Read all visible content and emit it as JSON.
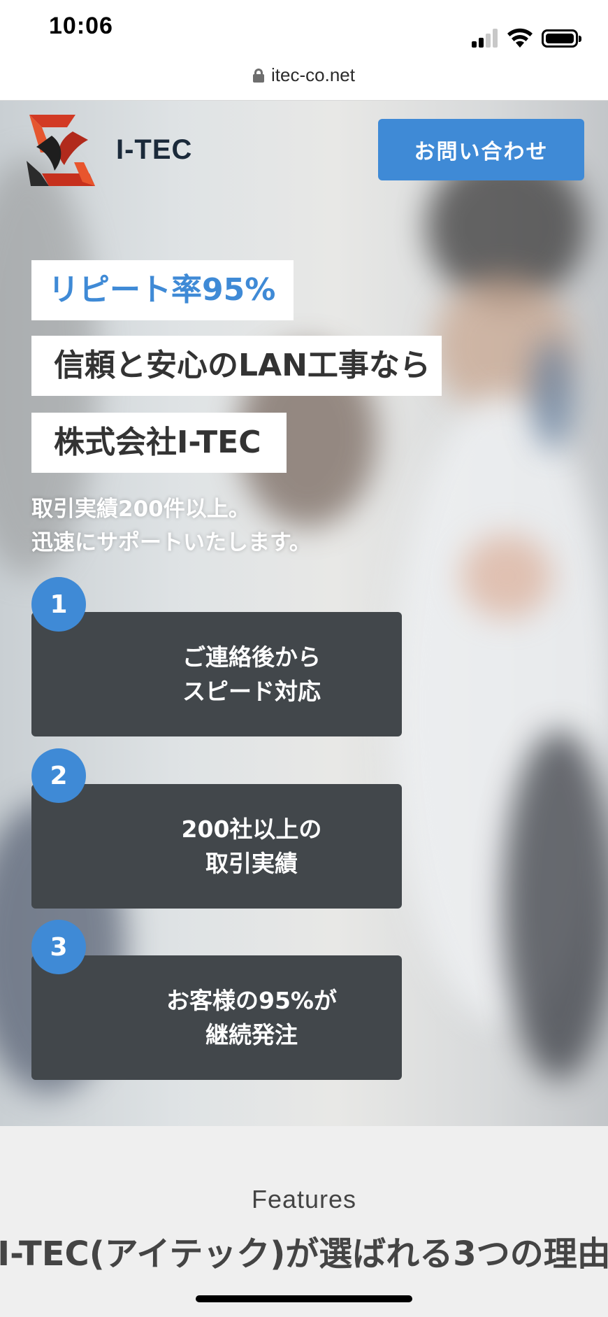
{
  "status_bar": {
    "time": "10:06"
  },
  "browser": {
    "url": "itec-co.net"
  },
  "header": {
    "brand": "I-TEC",
    "contact_button": "お問い合わせ"
  },
  "hero": {
    "tag_repeat": "リピート率95%",
    "tag_trust": "信頼と安心のLAN工事なら",
    "tag_company": "株式会社I-TEC",
    "sub_line_1": "取引実績200件以上。",
    "sub_line_2": "迅速にサポートいたします。",
    "accent_color": "#3f8ad6",
    "features": [
      {
        "number": "1",
        "line_1": "ご連絡後から",
        "line_2": "スピード対応"
      },
      {
        "number": "2",
        "line_1": "200社以上の",
        "line_2": "取引実績"
      },
      {
        "number": "3",
        "line_1": "お客様の95%が",
        "line_2": "継続発注"
      }
    ]
  },
  "features_section": {
    "label": "Features",
    "title": "I-TEC(アイテック)が選ばれる3つの理由"
  }
}
